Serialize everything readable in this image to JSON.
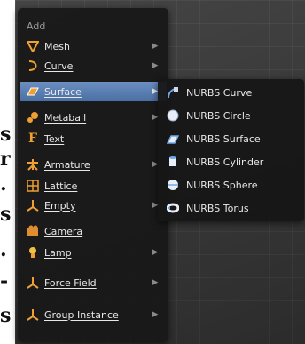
{
  "edge_text": [
    "s",
    "r",
    ".",
    "s",
    ".",
    "-",
    "s"
  ],
  "menu": {
    "title": "Add",
    "items": [
      {
        "label": "Mesh",
        "icon": "mesh-icon",
        "submenu": true
      },
      {
        "label": "Curve",
        "icon": "curve-icon",
        "submenu": true
      },
      {
        "label": "Surface",
        "icon": "surface-icon",
        "submenu": true,
        "active": true
      },
      {
        "label": "Metaball",
        "icon": "metaball-icon",
        "submenu": true
      },
      {
        "label": "Text",
        "icon": "text-icon",
        "submenu": false
      },
      {
        "label": "Armature",
        "icon": "armature-icon",
        "submenu": true
      },
      {
        "label": "Lattice",
        "icon": "lattice-icon",
        "submenu": false
      },
      {
        "label": "Empty",
        "icon": "empty-icon",
        "submenu": true
      },
      {
        "label": "Camera",
        "icon": "camera-icon",
        "submenu": false
      },
      {
        "label": "Lamp",
        "icon": "lamp-icon",
        "submenu": true
      },
      {
        "label": "Force Field",
        "icon": "force-field-icon",
        "submenu": true
      },
      {
        "label": "Group Instance",
        "icon": "group-instance-icon",
        "submenu": true
      }
    ]
  },
  "submenu": {
    "items": [
      {
        "label": "NURBS Curve",
        "icon": "nurbs-curve-icon"
      },
      {
        "label": "NURBS Circle",
        "icon": "nurbs-circle-icon"
      },
      {
        "label": "NURBS Surface",
        "icon": "nurbs-surface-icon"
      },
      {
        "label": "NURBS Cylinder",
        "icon": "nurbs-cylinder-icon"
      },
      {
        "label": "NURBS Sphere",
        "icon": "nurbs-sphere-icon"
      },
      {
        "label": "NURBS Torus",
        "icon": "nurbs-torus-icon"
      }
    ]
  },
  "colors": {
    "menu_bg": "#181818",
    "highlight": "#5a7fb5",
    "text": "#e8e8e8",
    "icon_orange": "#f0a030",
    "icon_blue": "#6fa8e8"
  }
}
